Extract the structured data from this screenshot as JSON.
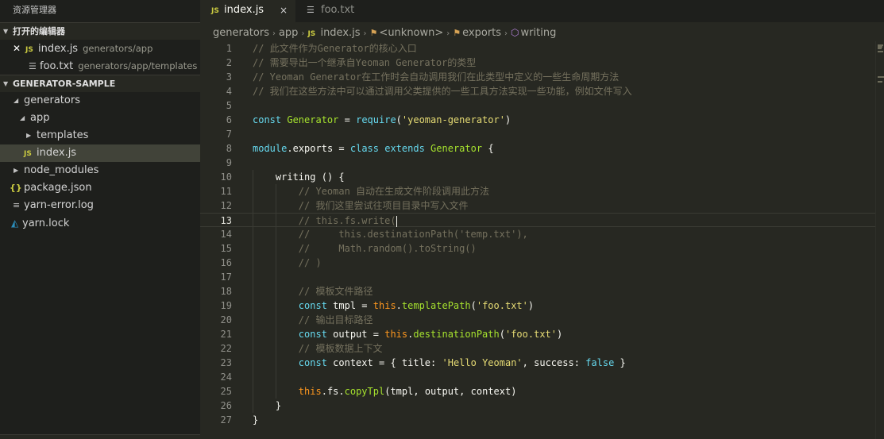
{
  "sidebar": {
    "title": "资源管理器",
    "open_editors": {
      "header": "打开的编辑器",
      "items": [
        {
          "name": "index.js",
          "desc": "generators/app"
        },
        {
          "name": "foo.txt",
          "desc": "generators/app/templates"
        }
      ]
    },
    "workspace": {
      "header": "GENERATOR-SAMPLE",
      "items": [
        {
          "label": "generators"
        },
        {
          "label": "app"
        },
        {
          "label": "templates"
        },
        {
          "label": "index.js"
        },
        {
          "label": "node_modules"
        },
        {
          "label": "package.json"
        },
        {
          "label": "yarn-error.log"
        },
        {
          "label": "yarn.lock"
        }
      ]
    }
  },
  "tabs": [
    {
      "label": "index.js",
      "badge": "JS",
      "close": "×"
    },
    {
      "label": "foo.txt"
    }
  ],
  "breadcrumb": [
    "generators",
    "app",
    "index.js",
    "<unknown>",
    "exports",
    "writing"
  ],
  "icons": {
    "js": "js-file-icon",
    "txt": "text-file-icon",
    "json": "braces-icon",
    "yarn": "yarn-icon",
    "close": "close-icon",
    "unknown": "symbol-unknown-icon",
    "method": "cube-icon"
  },
  "editor": {
    "current_line": 13,
    "lines": [
      "// 此文件作为Generator的核心入口",
      "// 需要导出一个继承自Yeoman Generator的类型",
      "// Yeoman Generator在工作时会自动调用我们在此类型中定义的一些生命周期方法",
      "// 我们在这些方法中可以通过调用父类提供的一些工具方法实现一些功能，例如文件写入",
      "",
      "const Generator = require('yeoman-generator')",
      "",
      "module.exports = class extends Generator {",
      "",
      "    writing () {",
      "        // Yeoman 自动在生成文件阶段调用此方法",
      "        // 我们这里尝试往项目目录中写入文件",
      "        // this.fs.write(",
      "        //     this.destinationPath('temp.txt'),",
      "        //     Math.random().toString()",
      "        // )",
      "",
      "        // 模板文件路径",
      "        const tmpl = this.templatePath('foo.txt')",
      "        // 输出目标路径",
      "        const output = this.destinationPath('foo.txt')",
      "        // 模板数据上下文",
      "        const context = { title: 'Hello Yeoman', success: false }",
      "",
      "        this.fs.copyTpl(tmpl, output, context)",
      "    }",
      "}"
    ]
  },
  "colors": {
    "background": "#272822",
    "sidebar": "#1e1f1c",
    "comment": "#75715e",
    "keyword": "#66d9ef",
    "class": "#a6e22e",
    "string": "#e6db74",
    "this": "#fd971f"
  }
}
